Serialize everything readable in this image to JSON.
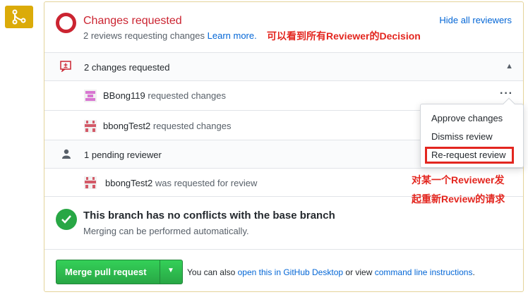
{
  "review_status": {
    "title": "Changes requested",
    "subtitle_prefix": "2 reviews requesting changes",
    "learn_more": "Learn more.",
    "hide_reviewers": "Hide all reviewers",
    "annotation": "可以看到所有Reviewer的Decision"
  },
  "changes_group": {
    "label": "2 changes requested",
    "reviews": [
      {
        "user": "BBong119",
        "action": "requested changes"
      },
      {
        "user": "bbongTest2",
        "action": "requested changes"
      }
    ]
  },
  "pending_group": {
    "label": "1 pending reviewer",
    "reviewers": [
      {
        "user": "bbongTest2",
        "action": "was requested for review"
      }
    ]
  },
  "review_menu": {
    "items": [
      "Approve changes",
      "Dismiss review",
      "Re-request review"
    ]
  },
  "side_annotation": {
    "line1": "对某一个Reviewer发",
    "line2": "起重新Review的请求"
  },
  "merge_status": {
    "title": "This branch has no conflicts with the base branch",
    "subtitle": "Merging can be performed automatically."
  },
  "merge_actions": {
    "button_label": "Merge pull request",
    "note_prefix": "You can also",
    "desktop_link": "open this in GitHub Desktop",
    "note_middle": "or view",
    "cli_link": "command line instructions",
    "note_suffix": "."
  },
  "colors": {
    "changes_red": "#cb2431",
    "success_green": "#28a745",
    "link_blue": "#0366d6",
    "annotation_red": "#e3261f",
    "merge_icon_bg": "#dbab09"
  }
}
